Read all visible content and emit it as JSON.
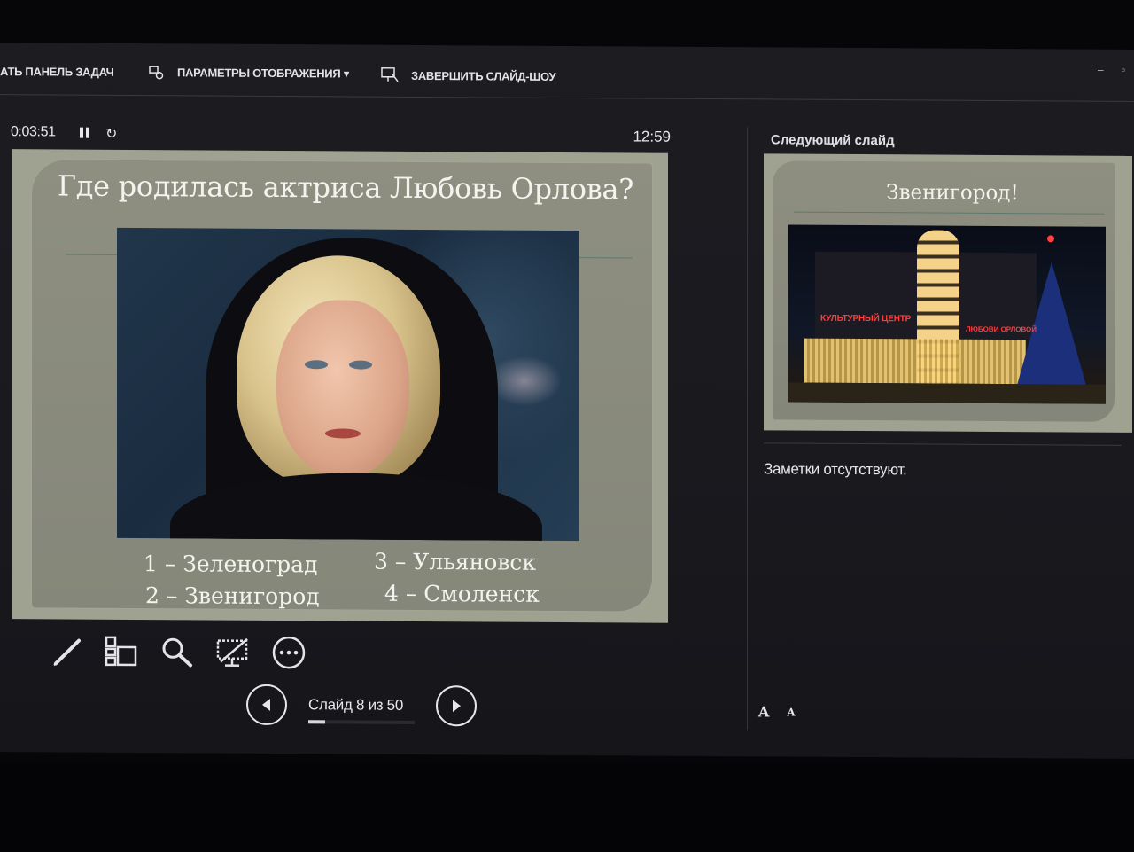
{
  "topbar": {
    "taskbar_label": "АТЬ ПАНЕЛЬ ЗАДАЧ",
    "display_settings_label": "ПАРАМЕТРЫ ОТОБРАЖЕНИЯ ▾",
    "end_show_label": "ЗАВЕРШИТЬ СЛАЙД-ШОУ",
    "minimize_glyph": "–",
    "restore_glyph": "▫"
  },
  "timer": {
    "elapsed": "0:03:51",
    "clock": "12:59"
  },
  "current_slide": {
    "title": "Где родилась актриса Любовь Орлова?",
    "answers": [
      "1 – Зеленоград",
      "2 – Звенигород",
      "3 – Ульяновск",
      "4 – Смоленск"
    ]
  },
  "toolbar": {
    "tools": [
      "pen-icon",
      "slides-grid-icon",
      "zoom-icon",
      "black-screen-icon",
      "more-options-icon"
    ]
  },
  "navigation": {
    "counter": "Слайд 8 из 50",
    "progress_fraction": 0.16
  },
  "next_slide": {
    "label": "Следующий слайд",
    "title": "Звенигород!",
    "sign_text": "КУЛЬТУРНЫЙ ЦЕНТР",
    "sign_text_2": "ЛЮБОВИ ОРЛОВОЙ"
  },
  "notes": {
    "text": "Заметки отсутствуют."
  },
  "font_controls": {
    "increase": "A",
    "decrease": "A"
  },
  "colors": {
    "slide_frame": "#9fa191",
    "slide_card": "#8e8f80",
    "background": "#1c1c21"
  }
}
